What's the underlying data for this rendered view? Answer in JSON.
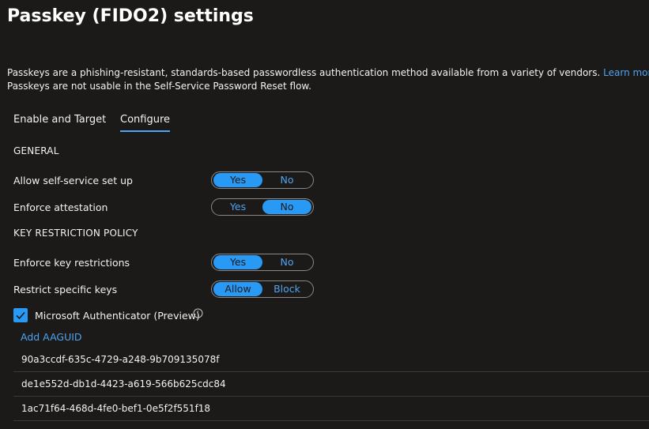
{
  "header": {
    "title": "Passkey (FIDO2) settings",
    "more_label": "···"
  },
  "description": {
    "line1": "Passkeys are a phishing-resistant, standards-based passwordless authentication method available from a variety of vendors.",
    "learn_more": "Learn more.",
    "line2": "Passkeys are not usable in the Self-Service Password Reset flow."
  },
  "tabs": [
    {
      "label": "Enable and Target",
      "active": false
    },
    {
      "label": "Configure",
      "active": true
    }
  ],
  "general": {
    "heading": "GENERAL",
    "allow_self_service": {
      "label": "Allow self-service set up",
      "options": [
        "Yes",
        "No"
      ],
      "selected": "Yes"
    },
    "enforce_attestation": {
      "label": "Enforce attestation",
      "options": [
        "Yes",
        "No"
      ],
      "selected": "No"
    }
  },
  "key_restriction": {
    "heading": "KEY RESTRICTION POLICY",
    "enforce_key_restrictions": {
      "label": "Enforce key restrictions",
      "options": [
        "Yes",
        "No"
      ],
      "selected": "Yes"
    },
    "restrict_specific_keys": {
      "label": "Restrict specific keys",
      "options": [
        "Allow",
        "Block"
      ],
      "selected": "Allow"
    },
    "microsoft_authenticator": {
      "label": "Microsoft Authenticator (Preview)",
      "checked": true,
      "icon": "info-icon"
    },
    "add_aaguid": "Add AAGUID",
    "aaguids": [
      "90a3ccdf-635c-4729-a248-9b709135078f",
      "de1e552d-db1d-4423-a619-566b625cdc84",
      "1ac71f64-468d-4fe0-bef1-0e5f2f551f18"
    ]
  },
  "colors": {
    "background": "#1b1a19",
    "accent": "#2899f5",
    "link": "#4fa3f0"
  }
}
